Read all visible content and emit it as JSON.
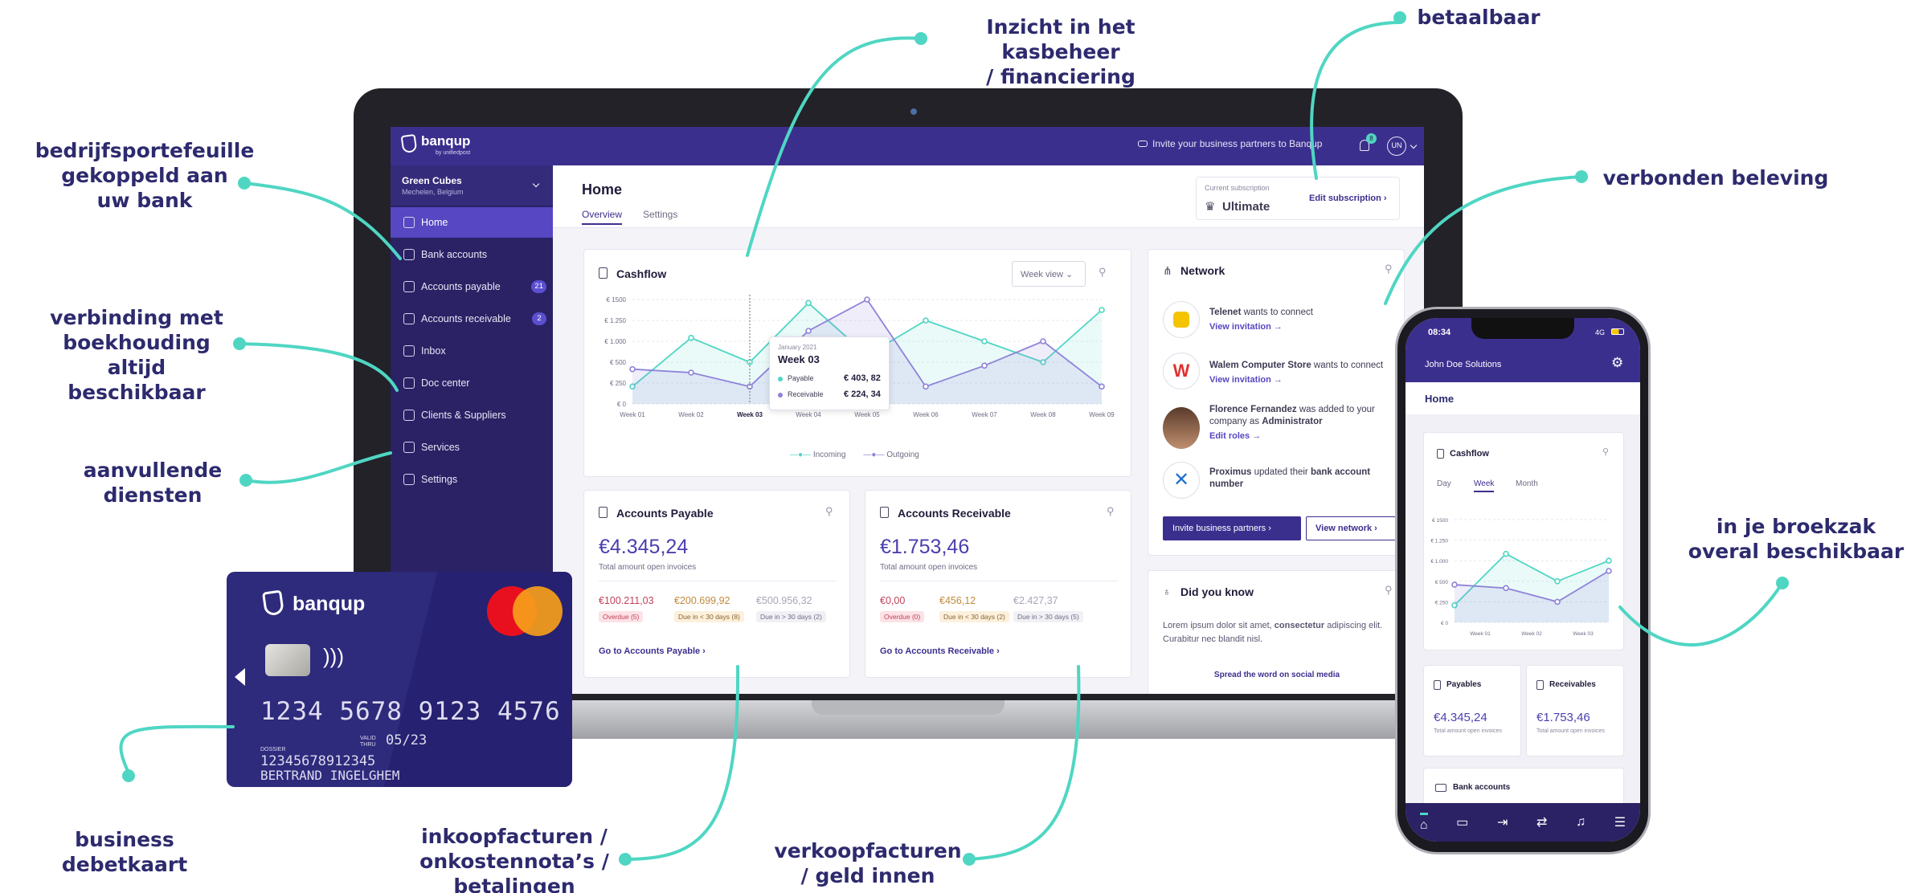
{
  "annotations": {
    "inzicht": [
      "Inzicht in het kasbeheer",
      "/ financiering"
    ],
    "betaalbaar": "betaalbaar",
    "bedrijf": [
      "bedrijfsportefeuille",
      "gekoppeld aan",
      "uw bank"
    ],
    "verbonden": "verbonden beleving",
    "verbinding": [
      "verbinding met",
      "boekhouding altijd",
      "beschikbaar"
    ],
    "aanvullende": [
      "aanvullende",
      "diensten"
    ],
    "broekzak": [
      "in je broekzak",
      "overal beschikbaar"
    ],
    "business": [
      "business",
      "debetkaart"
    ],
    "inkoop": [
      "inkoopfacturen /",
      "onkostennota’s /",
      "betalingen"
    ],
    "verkoop": [
      "verkoopfacturen",
      "/ geld innen"
    ]
  },
  "app": {
    "logo": "banqup",
    "logo_sub": "by unifiedpost",
    "invite_top": "Invite your business partners to Banqup",
    "notif_count": "8",
    "avatar": "UN",
    "company": "Green Cubes",
    "company_loc": "Mechelen, Belgium",
    "sidebar": [
      {
        "label": "Home",
        "icon": "home-icon"
      },
      {
        "label": "Bank accounts",
        "icon": "bank-card-icon"
      },
      {
        "label": "Accounts payable",
        "icon": "invoice-out-icon",
        "badge": "21"
      },
      {
        "label": "Accounts receivable",
        "icon": "invoice-in-icon",
        "badge": "2"
      },
      {
        "label": "Inbox",
        "icon": "inbox-icon"
      },
      {
        "label": "Doc center",
        "icon": "document-icon"
      },
      {
        "label": "Clients & Suppliers",
        "icon": "people-icon"
      },
      {
        "label": "Services",
        "icon": "grid-icon"
      },
      {
        "label": "Settings",
        "icon": "gear-icon"
      }
    ],
    "page_title": "Home",
    "tabs": [
      "Overview",
      "Settings"
    ],
    "subscription": {
      "label": "Current subscription",
      "plan": "Ultimate",
      "edit": "Edit subscription"
    },
    "cashflow": {
      "title": "Cashflow",
      "view": "Week view",
      "legend": [
        "Incoming",
        "Outgoing"
      ],
      "tooltip": {
        "date": "January 2021",
        "week": "Week 03",
        "payable_label": "Payable",
        "payable": "€ 403, 82",
        "receivable_label": "Receivable",
        "receivable": "€ 224, 34"
      }
    },
    "network": {
      "title": "Network",
      "items": [
        {
          "bold": "Telenet",
          "text": " wants to connect",
          "link": "View invitation"
        },
        {
          "bold": "Walem Computer Store",
          "text": " wants to connect",
          "link": "View invitation"
        },
        {
          "bold": "Florence Fernandez",
          "text": " was added to your company as ",
          "bold2": "Administrator",
          "link": "Edit roles"
        },
        {
          "bold": "Proximus",
          "text": " updated their ",
          "bold2": "bank account number",
          "link": ""
        }
      ],
      "invite_btn": "Invite business partners",
      "view_btn": "View network"
    },
    "payable": {
      "title": "Accounts Payable",
      "amount": "€4.345,24",
      "sub": "Total amount open invoices",
      "s1": "€100.211,03",
      "s1l": "Overdue (5)",
      "s2": "€200.699,92",
      "s2l": "Due in < 30 days (8)",
      "s3": "€500.956,32",
      "s3l": "Due in > 30 days (2)",
      "link": "Go to Accounts Payable"
    },
    "receivable": {
      "title": "Accounts Receivable",
      "amount": "€1.753,46",
      "sub": "Total amount open invoices",
      "s1": "€0,00",
      "s1l": "Overdue (0)",
      "s2": "€456,12",
      "s2l": "Due in < 30 days (2)",
      "s3": "€2.427,37",
      "s3l": "Due in > 30 days (5)",
      "link": "Go to Accounts Receivable"
    },
    "didyouknow": {
      "title": "Did you know",
      "text1": "Lorem ipsum dolor sit amet, ",
      "bold": "consectetur",
      "text2": " adipiscing elit. Curabitur nec blandit nisl.",
      "spread": "Spread the word on social media"
    }
  },
  "phone": {
    "time": "08:34",
    "signal": "4G",
    "company": "John Doe Solutions",
    "home": "Home",
    "cashflow": "Cashflow",
    "tabs": [
      "Day",
      "Week",
      "Month"
    ],
    "payables": "Payables",
    "payables_amt": "€4.345,24",
    "receivables": "Receivables",
    "receivables_amt": "€1.753,46",
    "open_sub": "Total amount open invoices",
    "bank": "Bank accounts"
  },
  "card": {
    "brand": "banqup",
    "number": "1234 5678 9123 4576",
    "valid_label": "VALID THRU",
    "valid": "05/23",
    "dossier_label": "DOSSIER",
    "dossier": "12345678912345",
    "holder": "BERTRAND INGELGHEM"
  },
  "colors": {
    "accent": "#3b2f8e",
    "teal": "#4fd6c3",
    "purple": "#8f82d9"
  },
  "chart_data": [
    {
      "type": "line",
      "title": "Cashflow",
      "categories": [
        "Week 01",
        "Week 02",
        "Week 03",
        "Week 04",
        "Week 05",
        "Week 06",
        "Week 07",
        "Week 08",
        "Week 09"
      ],
      "ylim": [
        0,
        1500
      ],
      "yticks": [
        "€ 0",
        "€ 250",
        "€ 500",
        "€ 1.000",
        "€ 1.250",
        "€ 1500"
      ],
      "series": [
        {
          "name": "Incoming",
          "values": [
            250,
            950,
            600,
            1450,
            700,
            1200,
            900,
            600,
            1350
          ]
        },
        {
          "name": "Outgoing",
          "values": [
            500,
            450,
            250,
            1050,
            1500,
            250,
            550,
            900,
            250
          ]
        }
      ]
    },
    {
      "type": "line",
      "title": "Cashflow",
      "categories": [
        "Week 01",
        "Week 02",
        "Week 03"
      ],
      "ylim": [
        0,
        1500
      ],
      "yticks": [
        "€ 0",
        "€ 250",
        "€ 500",
        "€ 1.000",
        "€ 1.250",
        "€ 1500"
      ],
      "series": [
        {
          "name": "Incoming",
          "values": [
            250,
            1000,
            600,
            900
          ]
        },
        {
          "name": "Outgoing",
          "values": [
            550,
            500,
            300,
            750
          ]
        }
      ]
    }
  ]
}
